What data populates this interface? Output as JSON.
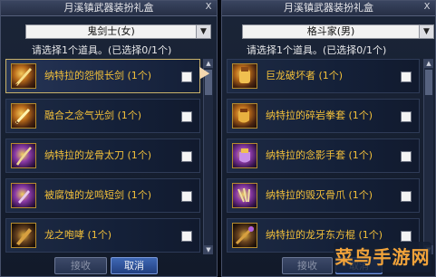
{
  "left_panel": {
    "title": "月溪镇武器装扮礼盒",
    "close_label": "X",
    "dropdown": {
      "value": "鬼剑士(女)",
      "arrow": "▼"
    },
    "hint": "请选择1个道具。(已选择0/1个)",
    "items": [
      {
        "name": "纳特拉的怨恨长剑",
        "count": "(1个)",
        "icon": "sword-icon"
      },
      {
        "name": "融合之念气光剑",
        "count": "(1个)",
        "icon": "lightsaber-icon"
      },
      {
        "name": "纳特拉的龙骨太刀",
        "count": "(1个)",
        "icon": "katana-icon"
      },
      {
        "name": "被腐蚀的龙鸣短剑",
        "count": "(1个)",
        "icon": "shortsword-icon"
      },
      {
        "name": "龙之咆哮",
        "count": "(1个)",
        "icon": "roar-blade-icon"
      }
    ],
    "buttons": {
      "confirm": "接收",
      "cancel": "取消"
    }
  },
  "right_panel": {
    "title": "月溪镇武器装扮礼盒",
    "close_label": "X",
    "dropdown": {
      "value": "格斗家(男)",
      "arrow": "▼"
    },
    "hint": "请选择1个道具。(已选择0/1个)",
    "items": [
      {
        "name": "巨龙破坏者",
        "count": "(1个)",
        "icon": "gauntlet-icon"
      },
      {
        "name": "纳特拉的碎岩拳套",
        "count": "(1个)",
        "icon": "fist-icon"
      },
      {
        "name": "纳特拉的念影手套",
        "count": "(1个)",
        "icon": "glove-icon"
      },
      {
        "name": "纳特拉的毁灭骨爪",
        "count": "(1个)",
        "icon": "claw-icon"
      },
      {
        "name": "纳特拉的龙牙东方棍",
        "count": "(1个)",
        "icon": "staff-icon"
      }
    ],
    "buttons": {
      "confirm": "接收",
      "cancel": "取消"
    }
  },
  "watermark": "菜鸟手游网",
  "colors": {
    "item_text": "#f3c03a",
    "panel_bg": "#1b2538",
    "primary_button": "#3f68b5"
  }
}
